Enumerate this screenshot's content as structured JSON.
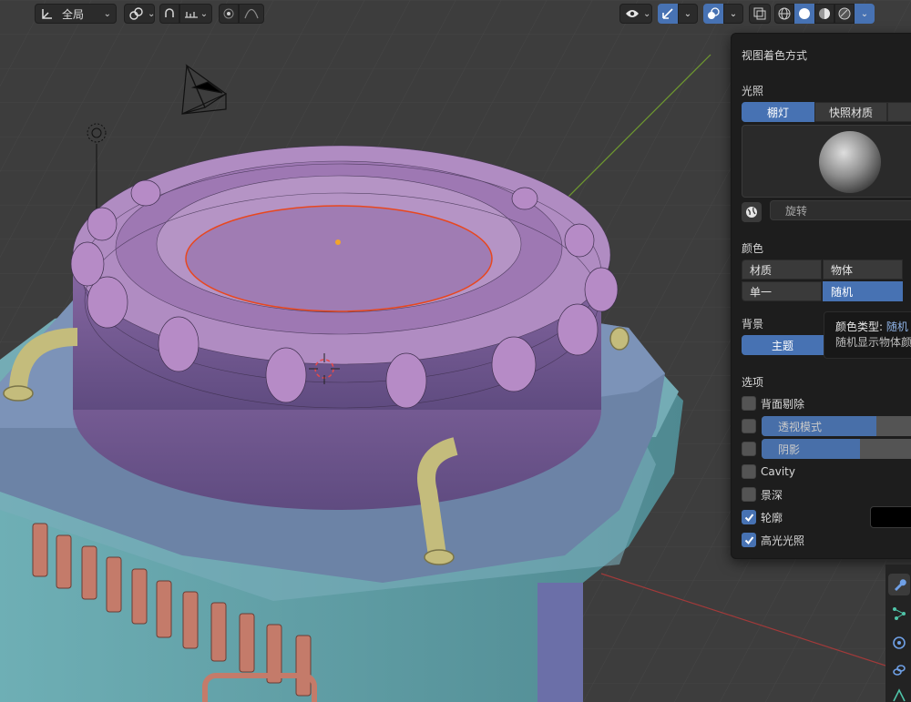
{
  "header": {
    "transform_pivot": {
      "label": "全局",
      "icon": "transform-orientation-icon"
    },
    "snap_icon": "snap-icon",
    "proportional_icon": "proportional-edit-icon",
    "overlay_icon": "overlay-icon",
    "gizmo_icon": "gizmo-icon",
    "xray_icon": "xray-toggle-icon",
    "shading_modes": [
      "wireframe",
      "solid",
      "material-preview",
      "rendered"
    ],
    "active_shading": "solid"
  },
  "popover": {
    "title": "视图着色方式",
    "lighting": {
      "label": "光照",
      "tabs": [
        "棚灯",
        "快照材质"
      ],
      "active": "棚灯",
      "rotate_label": "旋转"
    },
    "color": {
      "label": "颜色",
      "options": [
        "材质",
        "物体",
        "单一",
        "随机"
      ],
      "active": "随机"
    },
    "background": {
      "label": "背景",
      "options": [
        "主题"
      ],
      "active": "主题"
    },
    "options": {
      "label": "选项",
      "backface_culling": {
        "label": "背面剔除",
        "checked": false
      },
      "xray": {
        "label": "透视模式",
        "checked": false,
        "value_fraction": 0.7
      },
      "shadow": {
        "label": "阴影",
        "checked": false,
        "value_fraction": 0.6
      },
      "cavity": {
        "label": "Cavity",
        "checked": false
      },
      "depth_of_field": {
        "label": "景深",
        "checked": false
      },
      "outline": {
        "label": "轮廓",
        "checked": true,
        "color": "#000000"
      },
      "specular": {
        "label": "高光光照",
        "checked": true
      }
    }
  },
  "tooltip": {
    "line1_prefix": "颜色类型:",
    "line1_value": "随机",
    "line2": "随机显示物体颜"
  },
  "colors": {
    "accent": "#4772b3",
    "viewport_bg": "#3d3d3d",
    "panel_bg": "#1d1d1d",
    "object_purple": "#a77ab3",
    "object_teal": "#6ba5ad",
    "object_blue": "#6c83a6",
    "pipe_tan": "#c4bc7c"
  },
  "right_strip_icons": [
    "modifier-wrench-icon",
    "particles-icon",
    "physics-icon",
    "constraints-icon",
    "data-icon"
  ]
}
